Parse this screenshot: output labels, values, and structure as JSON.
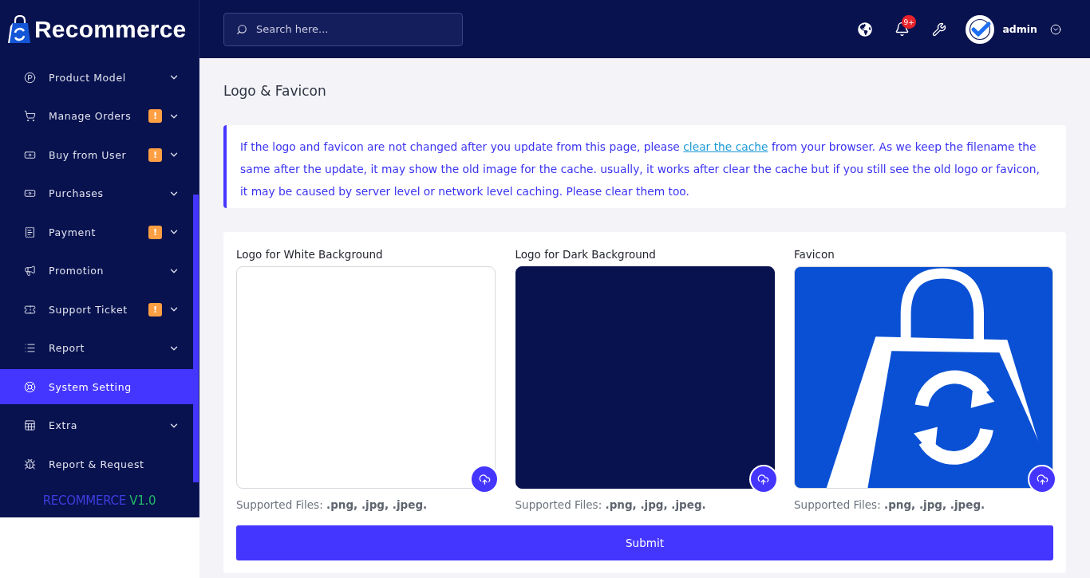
{
  "sidebar": {
    "brand": "Recommerce",
    "items": [
      {
        "label": "Product Model",
        "collapsible": true,
        "selected": false
      },
      {
        "label": "Manage Orders",
        "badge": "!",
        "collapsible": true,
        "selected": false
      },
      {
        "label": "Buy from User",
        "badge": "!",
        "collapsible": true,
        "selected": false
      },
      {
        "label": "Purchases",
        "collapsible": true,
        "selected": false
      },
      {
        "label": "Payment",
        "badge": "!",
        "collapsible": true,
        "selected": false
      },
      {
        "label": "Promotion",
        "collapsible": true,
        "selected": false
      },
      {
        "label": "Support Ticket",
        "badge": "!",
        "collapsible": true,
        "selected": false
      },
      {
        "label": "Report",
        "collapsible": true,
        "selected": false
      },
      {
        "label": "System Setting",
        "collapsible": false,
        "selected": true
      },
      {
        "label": "Extra",
        "collapsible": true,
        "selected": false
      },
      {
        "label": "Report & Request",
        "collapsible": false,
        "selected": false
      }
    ],
    "footer": {
      "product": "RECOMMERCE",
      "version": "V1.0"
    }
  },
  "header": {
    "search": {
      "placeholder": "Search here..."
    },
    "notifications": {
      "badge": "9+"
    },
    "user": {
      "name": "admin"
    }
  },
  "page": {
    "title": "Logo & Favicon",
    "notice": {
      "before": "If the logo and favicon are not changed after you update from this page, please ",
      "link": "clear the cache",
      "after": " from your browser. As we keep the filename the same after the update, it may show the old image for the cache. usually, it works after clear the cache but if you still see the old logo or favicon, it may be caused by server level or network level caching. Please clear them too."
    },
    "uploads": [
      {
        "kind": "light",
        "label": "Logo for White Background",
        "hint": "Supported Files: **.png, .jpg, .jpeg.**"
      },
      {
        "kind": "dark",
        "label": "Logo for Dark Background",
        "hint": "Supported Files: **.png, .jpg, .jpeg.**"
      },
      {
        "kind": "favicon",
        "label": "Favicon",
        "hint": "Supported Files: **.png, .jpg, .jpeg.**"
      }
    ],
    "submit": "Submit"
  }
}
